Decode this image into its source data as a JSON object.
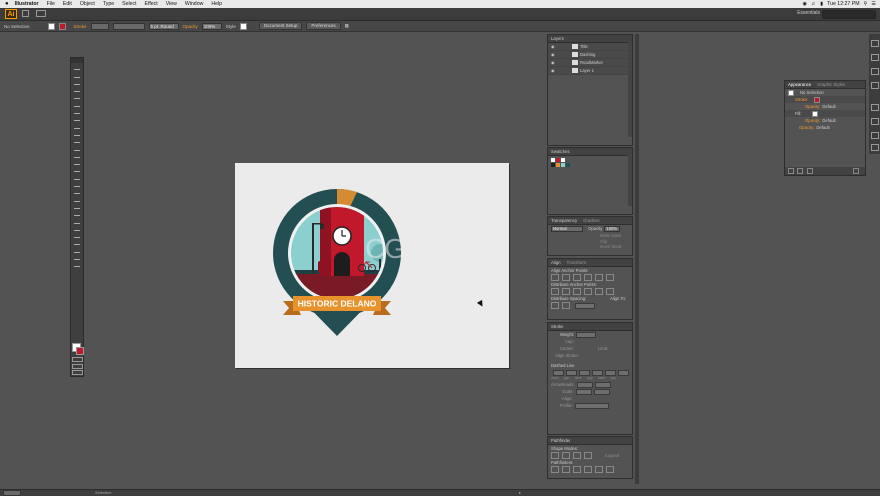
{
  "menubar": {
    "apple": "",
    "app": "Illustrator",
    "items": [
      "File",
      "Edit",
      "Object",
      "Type",
      "Select",
      "Effect",
      "View",
      "Window",
      "Help"
    ],
    "clock": "Tue 12:27 PM"
  },
  "appbar": {
    "logo": "Ai",
    "workspace": "Essentials"
  },
  "control": {
    "selection": "No Selection",
    "stroke_label": "Stroke",
    "brush": "5 pt. Round",
    "opacity_label": "Opacity",
    "opacity_value": "100%",
    "style_label": "Style",
    "doc_setup": "Document Setup",
    "preferences": "Preferences"
  },
  "artwork": {
    "banner_text": "HISTORIC DELANO",
    "colors": {
      "ring": "#234e52",
      "sky": "#8ccfcf",
      "tower": "#c2182b",
      "tower_dark": "#8e1222",
      "ribbon": "#e8922e",
      "ribbon_dark": "#b86c1c",
      "lamp": "#2a2a2a",
      "ground": "#7a1a26"
    }
  },
  "watermark": "CGer.com",
  "layers": {
    "title": "Layers",
    "items": [
      "Title",
      "Dashing",
      "RoadMarker",
      "Layer 1"
    ],
    "count": "4 Layers"
  },
  "swatches": {
    "title": "Swatches"
  },
  "transparency": {
    "tab1": "Transparency",
    "tab2": "Gradient",
    "mode": "Normal",
    "opacity_label": "Opacity",
    "opacity_value": "100%",
    "btn_mask": "Make Mask",
    "clip": "Clip",
    "invert": "Invert Mask"
  },
  "align": {
    "tab1": "Align",
    "tab2": "Transform",
    "align_objects": "Align Anchor Points:",
    "distribute_objects": "Distribute Anchor Points:",
    "distribute_spacing": "Distribute Spacing:",
    "align_to": "Align To:"
  },
  "stroke": {
    "title": "Stroke",
    "weight": "Weight:",
    "cap": "Cap:",
    "corner": "Corner:",
    "limit": "Limit:",
    "align": "Align Stroke:",
    "dashed": "Dashed Line",
    "dash_labels": [
      "dash",
      "gap",
      "dash",
      "gap",
      "dash",
      "gap"
    ],
    "arrowheads": "Arrowheads:",
    "scale": "Scale:",
    "align_arrows": "Align:",
    "profile": "Profile:"
  },
  "pathfinder": {
    "title": "Pathfinder",
    "shape_modes": "Shape Modes:",
    "pathfinders": "Pathfinders:",
    "expand": "Expand"
  },
  "appearance": {
    "tab1": "Appearance",
    "tab2": "Graphic Styles",
    "selection": "No Selection",
    "stroke": "Stroke:",
    "fill": "Fill:",
    "opacity": "Opacity:",
    "default": "Default"
  },
  "status": {
    "tool": "Selection"
  }
}
